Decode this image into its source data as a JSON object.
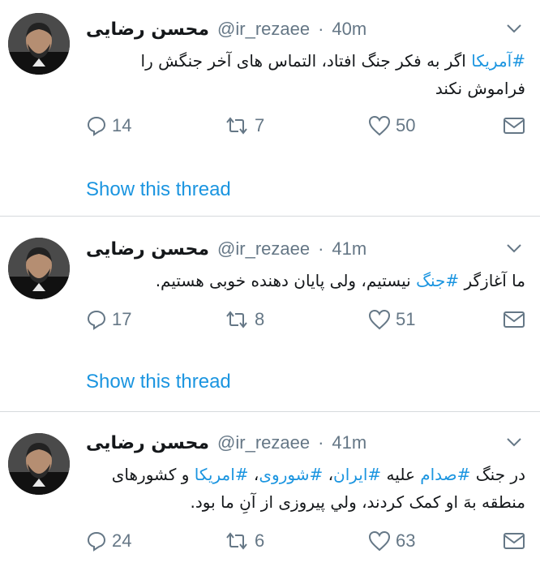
{
  "tweets": [
    {
      "name": "محسن رضایی",
      "handle": "@ir_rezaee",
      "separator": "·",
      "time": "40m",
      "text_parts": [
        "#آمریکا",
        " اگر به فکر جنگ افتاد، التماس های  آخر جنگش را فراموش نکند"
      ],
      "replies": "14",
      "retweets": "7",
      "likes": "50",
      "thread_link": "Show this thread"
    },
    {
      "name": "محسن رضایی",
      "handle": "@ir_rezaee",
      "separator": "·",
      "time": "41m",
      "text_parts": [
        "ما آغازگر ",
        "#جنگ",
        " نیستیم، ولی پایان دهنده خوبی هستیم."
      ],
      "replies": "17",
      "retweets": "8",
      "likes": "51",
      "thread_link": "Show this thread"
    },
    {
      "name": "محسن رضایی",
      "handle": "@ir_rezaee",
      "separator": "·",
      "time": "41m",
      "text_parts": [
        "در جنگ ",
        "#صدام",
        " علیه ",
        "#ایران",
        "، ",
        "#شوروی",
        "، ",
        "#امریکا",
        " و  کشورهای منطقه بهَ او کمک کردند، ولي پيروزی از  آنِ ما بود."
      ],
      "replies": "24",
      "retweets": "6",
      "likes": "63"
    }
  ],
  "icons": {
    "reply": "reply-icon",
    "retweet": "retweet-icon",
    "like": "heart-icon",
    "dm": "envelope-icon",
    "menu": "chevron-down-icon"
  },
  "colors": {
    "link": "#1b95e0",
    "muted": "#657786",
    "text": "#14171a",
    "divider": "#d6dadd"
  }
}
